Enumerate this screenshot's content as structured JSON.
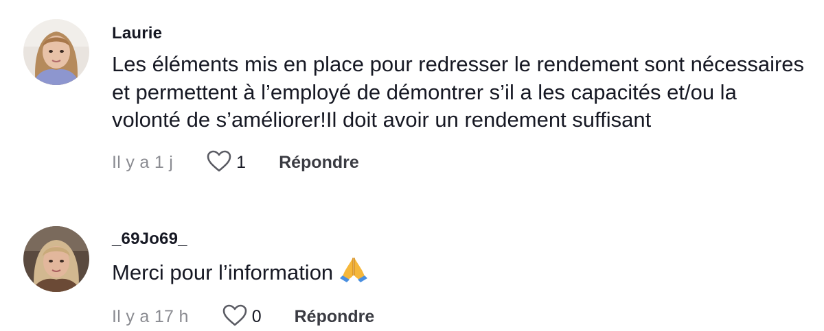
{
  "comments": [
    {
      "username": "Laurie",
      "text": "Les éléments mis en place pour redresser le rendement sont nécessaires et permettent à l’employé de démontrer s’il a les capacités et/ou la volonté de s’améliorer!Il doit avoir un rendement suffisant",
      "time": "Il y a 1 j",
      "likes": "1",
      "reply_label": "Répondre",
      "like_icon": "heart-outline-icon"
    },
    {
      "username": "_69Jo69_",
      "text": "Merci pour l’information",
      "emoji": "folded-hands-emoji",
      "time": "Il y a 17 h",
      "likes": "0",
      "reply_label": "Répondre",
      "like_icon": "heart-outline-icon"
    }
  ],
  "colors": {
    "text": "#161823",
    "meta": "#8a8b91",
    "reply": "#3a3b42"
  }
}
